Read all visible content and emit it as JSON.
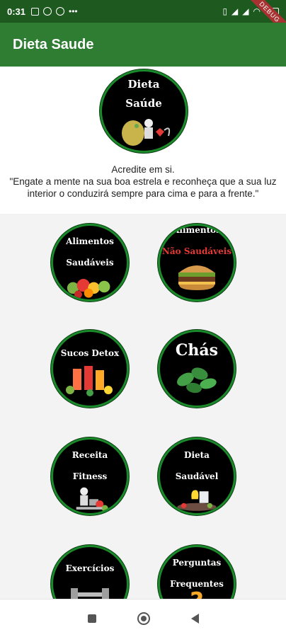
{
  "status_bar": {
    "time": "0:31",
    "left_icons": [
      "facebook-icon",
      "no-sync-icon",
      "no-sync-icon",
      "more-icon"
    ],
    "right_icons": [
      "vibrate-icon",
      "signal-icon",
      "signal-icon",
      "wifi-icon",
      "battery-icon"
    ],
    "battery_level": 0.5,
    "debug_banner": "DEBUG"
  },
  "appbar": {
    "title": "Dieta Saude"
  },
  "logo": {
    "line1": "Dieta",
    "line2": "Saúde"
  },
  "quote": {
    "line1": "Acredite em si.",
    "line2": "\"Engate a mente na sua boa estrela e reconheça que a sua luz interior o conduzirá sempre para cima e para a frente.\""
  },
  "categories": [
    {
      "line1": "Alimentos",
      "line2": "Saudáveis"
    },
    {
      "line1": "Alimentos",
      "line2": "Não Saudáveis"
    },
    {
      "line1": "Sucos Detox",
      "line2": ""
    },
    {
      "line1": "Chás",
      "line2": ""
    },
    {
      "line1": "Receita",
      "line2": "Fitness"
    },
    {
      "line1": "Dieta",
      "line2": "Saudável"
    },
    {
      "line1": "Exercícios",
      "line2": ""
    },
    {
      "line1": "Perguntas",
      "line2": "Frequentes"
    }
  ],
  "colors": {
    "appbar": "#2e7d32",
    "statusbar": "#1e5a20",
    "circle_border": "#1b8a2a",
    "accent_red": "#e53935"
  },
  "nav_icons": [
    "square-icon",
    "home-circle-icon",
    "back-triangle-icon"
  ]
}
